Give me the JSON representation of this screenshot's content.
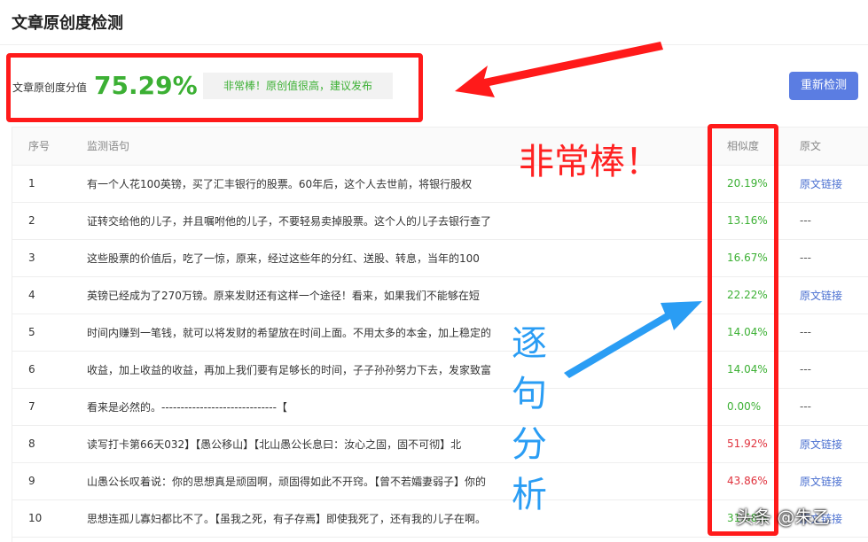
{
  "dialog": {
    "title": "文章原创度检测"
  },
  "score": {
    "label": "文章原创度分值",
    "value": "75.29%",
    "verdict": "非常棒！原创值很高，建议发布"
  },
  "actions": {
    "recheck_label": "重新检测"
  },
  "table": {
    "headers": {
      "index": "序号",
      "sentence": "监测语句",
      "similarity": "相似度",
      "source": "原文"
    },
    "rows": [
      {
        "index": "1",
        "sentence": "有一个人花100英镑，买了汇丰银行的股票。60年后，这个人去世前，将银行股权",
        "similarity": "20.19%",
        "level": "ok",
        "source": "原文链接"
      },
      {
        "index": "2",
        "sentence": "证转交给他的儿子，并且嘱咐他的儿子，不要轻易卖掉股票。这个人的儿子去银行查了",
        "similarity": "13.16%",
        "level": "ok",
        "source": "---"
      },
      {
        "index": "3",
        "sentence": "这些股票的价值后，吃了一惊，原来，经过这些年的分红、送股、转息，当年的100",
        "similarity": "16.67%",
        "level": "ok",
        "source": "---"
      },
      {
        "index": "4",
        "sentence": "英镑已经成为了270万镑。原来发财还有这样一个途径！看来，如果我们不能够在短",
        "similarity": "22.22%",
        "level": "ok",
        "source": "原文链接"
      },
      {
        "index": "5",
        "sentence": "时间内赚到一笔钱，就可以将发财的希望放在时间上面。不用太多的本金，加上稳定的",
        "similarity": "14.04%",
        "level": "ok",
        "source": "---"
      },
      {
        "index": "6",
        "sentence": "收益，加上收益的收益，再加上我们要有足够长的时间，子子孙孙努力下去，发家致富",
        "similarity": "14.04%",
        "level": "ok",
        "source": "---"
      },
      {
        "index": "7",
        "sentence": "看来是必然的。------------------------------【",
        "similarity": "0.00%",
        "level": "ok",
        "source": "---"
      },
      {
        "index": "8",
        "sentence": "读写打卡第66天032】【愚公移山】【北山愚公长息曰：汝心之固，固不可彻】北",
        "similarity": "51.92%",
        "level": "high",
        "source": "原文链接"
      },
      {
        "index": "9",
        "sentence": "山愚公长叹着说：你的思想真是顽固啊，顽固得如此不开窍。【曾不若孀妻弱子】你的",
        "similarity": "43.86%",
        "level": "high",
        "source": "原文链接"
      },
      {
        "index": "10",
        "sentence": "思想连孤儿寡妇都比不了。【虽我之死，有子存焉】即使我死了，还有我的儿子在啊。",
        "similarity": "31.58%",
        "level": "ok",
        "source": "原文链接"
      }
    ]
  },
  "annotations": {
    "praise": "非常棒！",
    "sentence_analysis": [
      "逐",
      "句",
      "分",
      "析"
    ],
    "box_color": "#ff1a1a",
    "arrow_red": "#ff1a1a",
    "arrow_blue": "#2a9df4"
  },
  "watermark": "头条 @朱乙",
  "colors": {
    "accent": "#5b7de2",
    "good": "#3cb034",
    "warn": "#e0323d",
    "link": "#4a6fd0"
  }
}
